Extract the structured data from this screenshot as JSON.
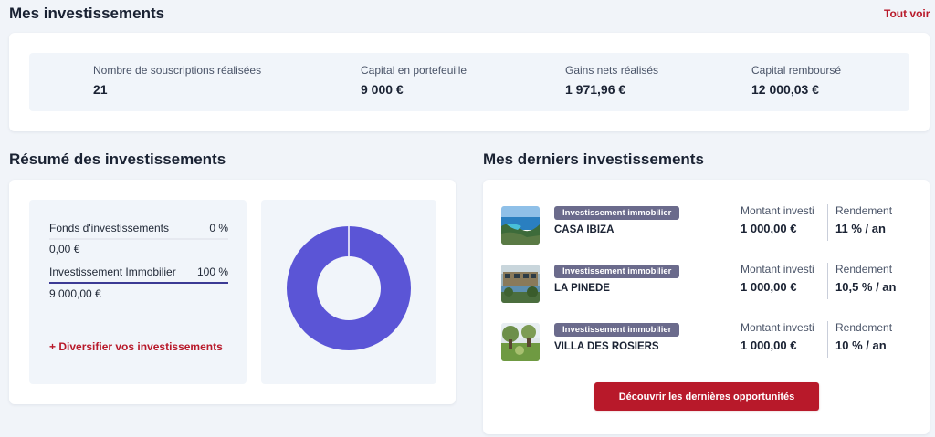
{
  "header": {
    "title": "Mes investissements",
    "see_all": "Tout voir"
  },
  "stats": [
    {
      "label": "Nombre de souscriptions réalisées",
      "value": "21"
    },
    {
      "label": "Capital en portefeuille",
      "value": "9 000 €"
    },
    {
      "label": "Gains nets réalisés",
      "value": "1 971,96 €"
    },
    {
      "label": "Capital remboursé",
      "value": "12 000,03 €"
    }
  ],
  "summary": {
    "title": "Résumé des investissements",
    "funds": [
      {
        "name": "Fonds d'investissements",
        "percent": "0 %",
        "amount": "0,00 €"
      },
      {
        "name": "Investissement Immobilier",
        "percent": "100 %",
        "amount": "9 000,00 €"
      }
    ],
    "diversify_link": "+ Diversifier vos investissements",
    "colors": {
      "immobilier": "#5b55d6",
      "fonds": "#e6e9f0"
    }
  },
  "chart_data": {
    "type": "pie",
    "categories": [
      "Fonds d'investissements",
      "Investissement Immobilier"
    ],
    "values": [
      0,
      100
    ]
  },
  "recent": {
    "title": "Mes derniers investissements",
    "amount_label": "Montant investi",
    "yield_label": "Rendement",
    "items": [
      {
        "tag": "Investissement immobilier",
        "name": "CASA IBIZA",
        "amount": "1 000,00 €",
        "yield": "11 % / an",
        "thumb_icon": "beach-photo"
      },
      {
        "tag": "Investissement immobilier",
        "name": "LA PINEDE",
        "amount": "1 000,00 €",
        "yield": "10,5 % / an",
        "thumb_icon": "building-photo"
      },
      {
        "tag": "Investissement immobilier",
        "name": "VILLA DES ROSIERS",
        "amount": "1 000,00 €",
        "yield": "10 % / an",
        "thumb_icon": "garden-photo"
      }
    ],
    "cta": "Découvrir les dernières opportunités"
  },
  "colors": {
    "accent_red": "#b8192a",
    "tag_bg": "#6b6b8c",
    "page_bg": "#f1f4f9",
    "panel_bg": "#f1f5fa"
  }
}
